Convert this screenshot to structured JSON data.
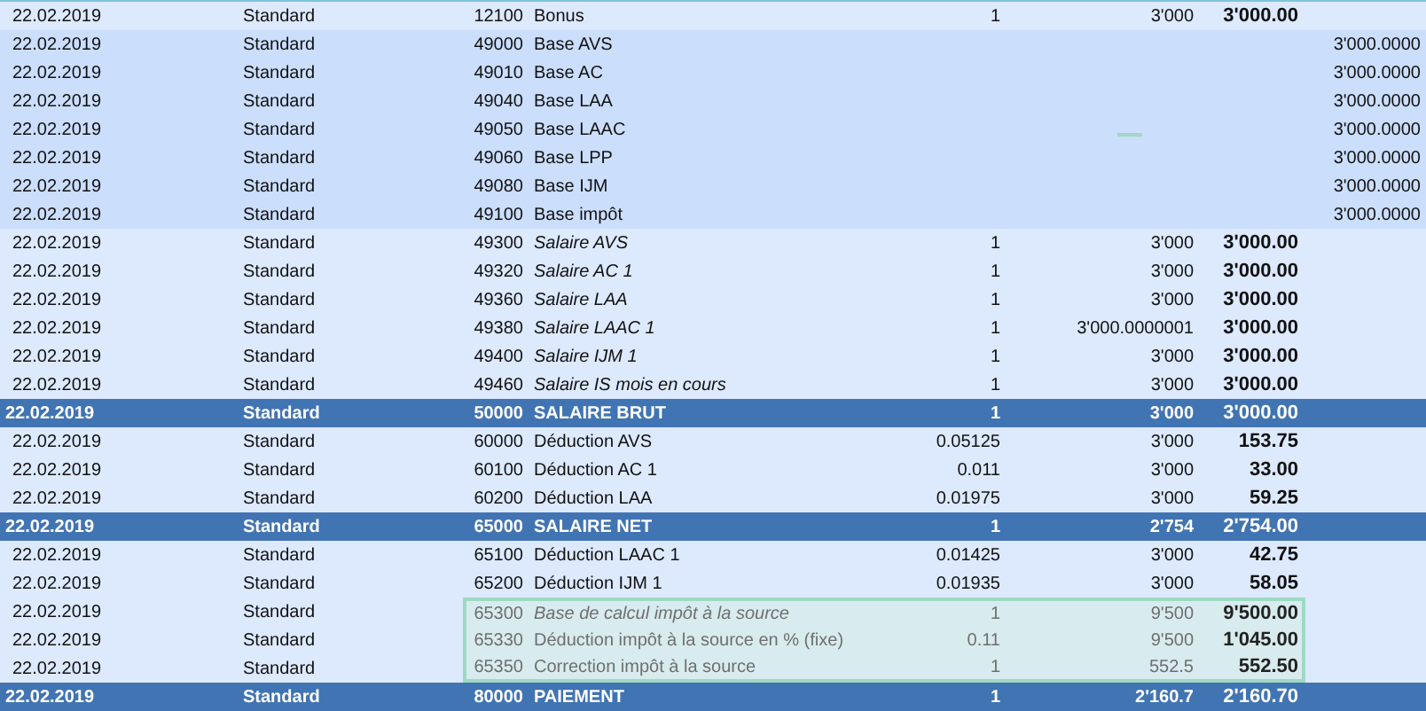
{
  "rows": [
    {
      "kind": "normal",
      "italic": false,
      "date": "22.02.2019",
      "type": "Standard",
      "code": "12100",
      "label": "Bonus",
      "qty": "1",
      "rate": "3'000",
      "amount": "3'000.00"
    },
    {
      "kind": "base",
      "italic": false,
      "date": "22.02.2019",
      "type": "Standard",
      "code": "49000",
      "label": "Base AVS",
      "base": "3'000.0000"
    },
    {
      "kind": "base",
      "italic": false,
      "date": "22.02.2019",
      "type": "Standard",
      "code": "49010",
      "label": "Base AC",
      "base": "3'000.0000"
    },
    {
      "kind": "base",
      "italic": false,
      "date": "22.02.2019",
      "type": "Standard",
      "code": "49040",
      "label": "Base LAA",
      "base": "3'000.0000"
    },
    {
      "kind": "base",
      "italic": false,
      "date": "22.02.2019",
      "type": "Standard",
      "code": "49050",
      "label": "Base LAAC",
      "base": "3'000.0000",
      "dash": true
    },
    {
      "kind": "base",
      "italic": false,
      "date": "22.02.2019",
      "type": "Standard",
      "code": "49060",
      "label": "Base LPP",
      "base": "3'000.0000"
    },
    {
      "kind": "base",
      "italic": false,
      "date": "22.02.2019",
      "type": "Standard",
      "code": "49080",
      "label": "Base IJM",
      "base": "3'000.0000"
    },
    {
      "kind": "base",
      "italic": false,
      "date": "22.02.2019",
      "type": "Standard",
      "code": "49100",
      "label": "Base impôt",
      "base": "3'000.0000"
    },
    {
      "kind": "normal",
      "italic": true,
      "date": "22.02.2019",
      "type": "Standard",
      "code": "49300",
      "label": "Salaire AVS",
      "qty": "1",
      "rate": "3'000",
      "amount": "3'000.00"
    },
    {
      "kind": "normal",
      "italic": true,
      "date": "22.02.2019",
      "type": "Standard",
      "code": "49320",
      "label": "Salaire AC 1",
      "qty": "1",
      "rate": "3'000",
      "amount": "3'000.00"
    },
    {
      "kind": "normal",
      "italic": true,
      "date": "22.02.2019",
      "type": "Standard",
      "code": "49360",
      "label": "Salaire LAA",
      "qty": "1",
      "rate": "3'000",
      "amount": "3'000.00"
    },
    {
      "kind": "normal",
      "italic": true,
      "date": "22.02.2019",
      "type": "Standard",
      "code": "49380",
      "label": "Salaire LAAC 1",
      "qty": "1",
      "rate": "3'000.0000001",
      "amount": "3'000.00"
    },
    {
      "kind": "normal",
      "italic": true,
      "date": "22.02.2019",
      "type": "Standard",
      "code": "49400",
      "label": "Salaire IJM 1",
      "qty": "1",
      "rate": "3'000",
      "amount": "3'000.00"
    },
    {
      "kind": "normal",
      "italic": true,
      "date": "22.02.2019",
      "type": "Standard",
      "code": "49460",
      "label": "Salaire IS mois en cours",
      "qty": "1",
      "rate": "3'000",
      "amount": "3'000.00"
    },
    {
      "kind": "total",
      "italic": false,
      "date": "22.02.2019",
      "type": "Standard",
      "code": "50000",
      "label": "SALAIRE BRUT",
      "qty": "1",
      "rate": "3'000",
      "amount": "3'000.00"
    },
    {
      "kind": "normal",
      "italic": false,
      "date": "22.02.2019",
      "type": "Standard",
      "code": "60000",
      "label": "Déduction AVS",
      "qty": "0.05125",
      "rate": "3'000",
      "amount": "153.75"
    },
    {
      "kind": "normal",
      "italic": false,
      "date": "22.02.2019",
      "type": "Standard",
      "code": "60100",
      "label": "Déduction AC 1",
      "qty": "0.011",
      "rate": "3'000",
      "amount": "33.00"
    },
    {
      "kind": "normal",
      "italic": false,
      "date": "22.02.2019",
      "type": "Standard",
      "code": "60200",
      "label": "Déduction LAA",
      "qty": "0.01975",
      "rate": "3'000",
      "amount": "59.25"
    },
    {
      "kind": "total",
      "italic": false,
      "date": "22.02.2019",
      "type": "Standard",
      "code": "65000",
      "label": "SALAIRE NET",
      "qty": "1",
      "rate": "2'754",
      "amount": "2'754.00"
    },
    {
      "kind": "normal",
      "italic": false,
      "date": "22.02.2019",
      "type": "Standard",
      "code": "65100",
      "label": "Déduction LAAC 1",
      "qty": "0.01425",
      "rate": "3'000",
      "amount": "42.75"
    },
    {
      "kind": "normal",
      "italic": false,
      "date": "22.02.2019",
      "type": "Standard",
      "code": "65200",
      "label": "Déduction IJM 1",
      "qty": "0.01935",
      "rate": "3'000",
      "amount": "58.05"
    },
    {
      "kind": "tax",
      "italic": true,
      "date": "22.02.2019",
      "type": "Standard",
      "code": "65300",
      "label": "Base de calcul impôt à la source",
      "qty": "1",
      "rate": "9'500",
      "amount": "9'500.00"
    },
    {
      "kind": "tax",
      "italic": false,
      "date": "22.02.2019",
      "type": "Standard",
      "code": "65330",
      "label": "Déduction impôt à la source en % (fixe)",
      "qty": "0.11",
      "rate": "9'500",
      "amount": "1'045.00"
    },
    {
      "kind": "tax",
      "italic": false,
      "date": "22.02.2019",
      "type": "Standard",
      "code": "65350",
      "label": "Correction impôt à la source",
      "qty": "1",
      "rate": "552.5",
      "amount": "552.50"
    },
    {
      "kind": "total",
      "italic": false,
      "date": "22.02.2019",
      "type": "Standard",
      "code": "80000",
      "label": "PAIEMENT",
      "qty": "1",
      "rate": "2'160.7",
      "amount": "2'160.70"
    }
  ]
}
